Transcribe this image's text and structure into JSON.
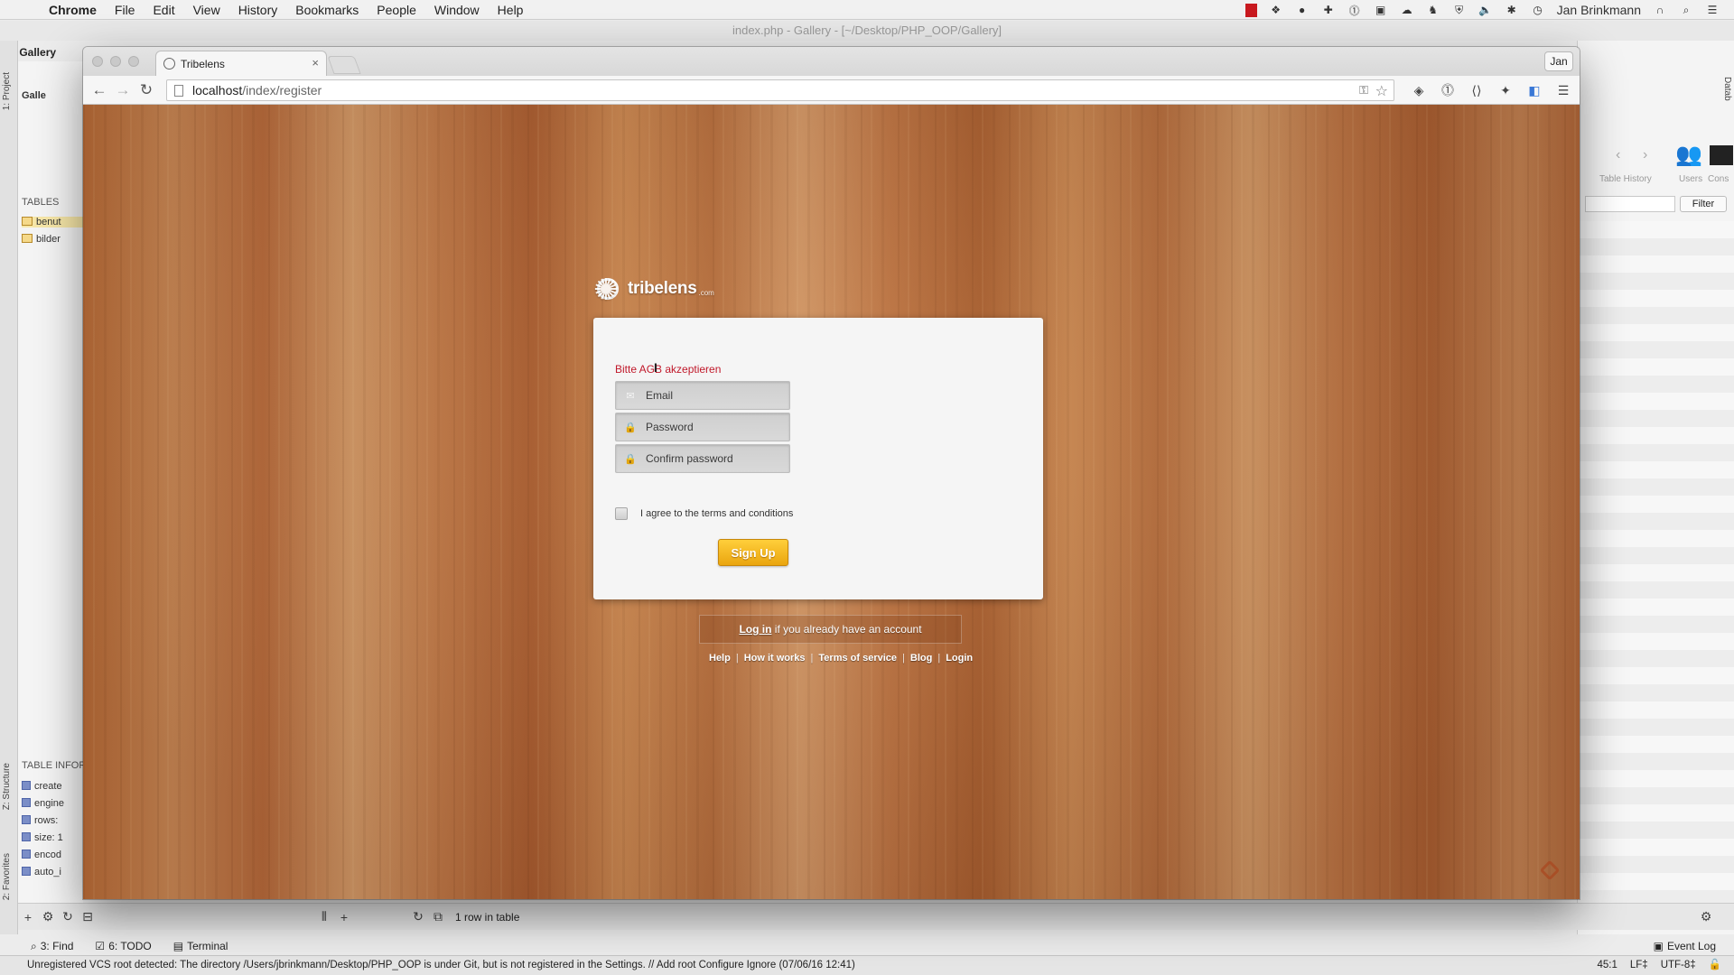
{
  "menubar": {
    "app": "Chrome",
    "items": [
      "File",
      "Edit",
      "View",
      "History",
      "Bookmarks",
      "People",
      "Window",
      "Help"
    ],
    "user": "Jan Brinkmann"
  },
  "ide": {
    "window_title": "index.php - Gallery - [~/Desktop/PHP_OOP/Gallery]",
    "breadcrumb": [
      "Gallery"
    ],
    "project_tab": "1: Project",
    "structure_tab": "Z: Structure",
    "favorites_tab": "2: Favorites",
    "project_root": "Galle",
    "tables_header": "TABLES",
    "tables": [
      "benut",
      "bilder"
    ],
    "table_info_header": "TABLE INFOR",
    "table_info": [
      "create",
      "engine",
      "rows:",
      "size: 1",
      "encod",
      "auto_i"
    ],
    "right_labels": [
      "Table History",
      "Users",
      "Cons"
    ],
    "filter_label": "Filter",
    "database_tab": "Datab",
    "rows_status": "1 row in table",
    "tool_windows": [
      "3: Find",
      "6: TODO",
      "Terminal"
    ],
    "event_log": "Event Log",
    "status_message": "Unregistered VCS root detected: The directory /Users/jbrinkmann/Desktop/PHP_OOP is under Git, but is not registered in the Settings. // Add root  Configure  Ignore (07/06/16 12:41)",
    "cursor_pos": "45:1",
    "line_sep": "LF‡",
    "encoding": "UTF-8‡"
  },
  "chrome": {
    "tab_title": "Tribelens",
    "profile": "Jan",
    "url_host": "localhost",
    "url_path": "/index/register"
  },
  "page": {
    "brand": "tribelens",
    "brand_suffix": ".com",
    "error": "Bitte AGB akzeptieren",
    "email_placeholder": "Email",
    "password_placeholder": "Password",
    "confirm_placeholder": "Confirm password",
    "terms_label": "I agree to the terms and conditions",
    "signup_label": "Sign Up",
    "login_link": "Log in",
    "login_rest": " if you already have an account",
    "footer_links": [
      "Help",
      "How it works",
      "Terms of service",
      "Blog",
      "Login"
    ]
  }
}
